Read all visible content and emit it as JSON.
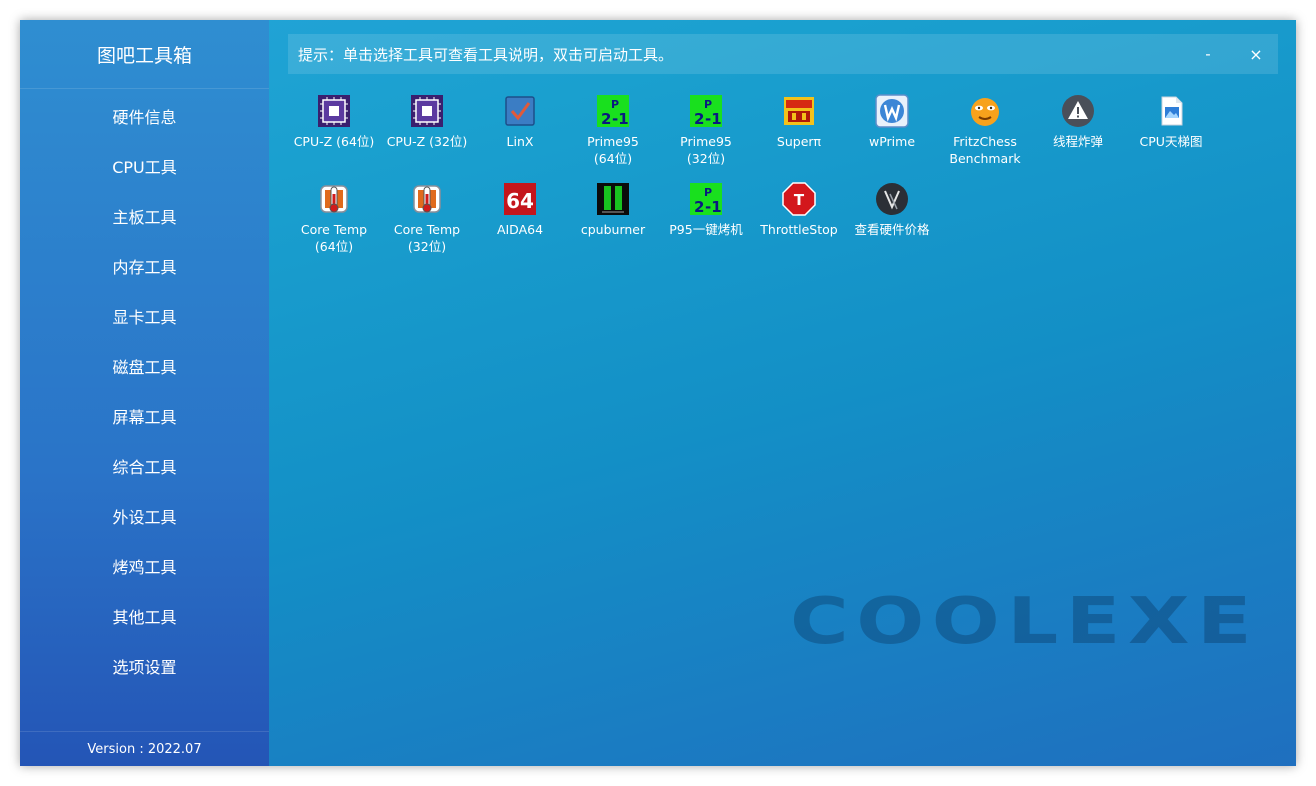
{
  "app": {
    "title": "图吧工具箱",
    "version": "Version : 2022.07"
  },
  "hint": "提示：单击选择工具可查看工具说明，双击可启动工具。",
  "window_controls": {
    "minimize": "-",
    "close": "×"
  },
  "sidebar": {
    "items": [
      {
        "label": "硬件信息"
      },
      {
        "label": "CPU工具"
      },
      {
        "label": "主板工具"
      },
      {
        "label": "内存工具"
      },
      {
        "label": "显卡工具"
      },
      {
        "label": "磁盘工具"
      },
      {
        "label": "屏幕工具"
      },
      {
        "label": "综合工具"
      },
      {
        "label": "外设工具"
      },
      {
        "label": "烤鸡工具"
      },
      {
        "label": "其他工具"
      },
      {
        "label": "选项设置"
      }
    ]
  },
  "tools": [
    {
      "label": "CPU-Z (64位)",
      "icon": "cpuz-icon"
    },
    {
      "label": "CPU-Z (32位)",
      "icon": "cpuz-icon"
    },
    {
      "label": "LinX",
      "icon": "linx-icon"
    },
    {
      "label": "Prime95\n(64位)",
      "icon": "prime95-icon"
    },
    {
      "label": "Prime95\n(32位)",
      "icon": "prime95-icon"
    },
    {
      "label": "Superπ",
      "icon": "superpi-icon"
    },
    {
      "label": "wPrime",
      "icon": "wprime-icon"
    },
    {
      "label": "FritzChess\nBenchmark",
      "icon": "fritzchess-icon"
    },
    {
      "label": "线程炸弹",
      "icon": "warning-icon"
    },
    {
      "label": "CPU天梯图",
      "icon": "image-file-icon"
    },
    {
      "label": "Core Temp\n(64位)",
      "icon": "coretemp-icon"
    },
    {
      "label": "Core Temp\n(32位)",
      "icon": "coretemp-icon"
    },
    {
      "label": "AIDA64",
      "icon": "aida64-icon",
      "icon_text": "64"
    },
    {
      "label": "cpuburner",
      "icon": "cpuburner-icon"
    },
    {
      "label": "P95一键烤机",
      "icon": "prime95-icon"
    },
    {
      "label": "ThrottleStop",
      "icon": "throttlestop-icon",
      "icon_text": "T"
    },
    {
      "label": "查看硬件价格",
      "icon": "price-icon"
    }
  ],
  "watermark": "COOLEXE"
}
